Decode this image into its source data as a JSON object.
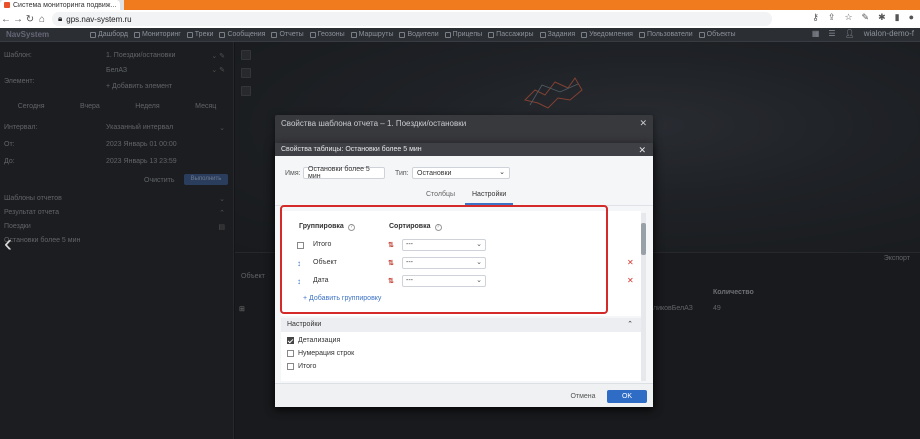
{
  "browser": {
    "tab_title": "Система мониторинга подвиж...",
    "url": "gps.nav-system.ru"
  },
  "app": {
    "logo": "NavSystem",
    "nav": [
      "Дашборд",
      "Мониторинг",
      "Треки",
      "Сообщения",
      "Отчеты",
      "Геозоны",
      "Маршруты",
      "Водители",
      "Прицепы",
      "Пассажиры",
      "Задания",
      "Уведомления",
      "Пользователи",
      "Объекты"
    ],
    "user": "wialon-demo-f"
  },
  "left_panel": {
    "template_label": "Шаблон:",
    "template_value": "1. Поездки/остановки",
    "element_label": "Элемент:",
    "element_value": "БелАЗ",
    "add_element": "+ Добавить элемент",
    "periods": [
      "Сегодня",
      "Вчера",
      "Неделя",
      "Месяц"
    ],
    "interval_label": "Интервал:",
    "interval_value": "Указанный интервал",
    "from_label": "От:",
    "from_value": "2023 Январь 01 00:00",
    "to_label": "До:",
    "to_value": "2023 Январь 13 23:59",
    "clear": "Очистить",
    "execute": "Выполнить",
    "templates": "Шаблоны отчетов",
    "result": "Результат отчета",
    "trips": "Поездки",
    "stops": "Остановки более 5 мин"
  },
  "report": {
    "object_label": "Объект",
    "col_count": "Количество",
    "export": "Экспорт",
    "cell_name": "ликовБелАЗ",
    "cell_count": "49"
  },
  "outer_dialog": {
    "title": "Свойства шаблона отчета – 1. Поездки/остановки"
  },
  "dialog": {
    "title": "Свойства таблицы: Остановки более 5 мин",
    "name_label": "Имя:",
    "name_value": "Остановки более 5 мин",
    "type_label": "Тип:",
    "type_value": "Остановки",
    "tabs": [
      "Столбцы",
      "Настройки"
    ],
    "active_tab": "Настройки",
    "grouping_header": "Группировка",
    "sorting_header": "Сортировка",
    "rows": [
      {
        "name": "Итого",
        "sort": "---",
        "draggable": false,
        "deletable": false
      },
      {
        "name": "Объект",
        "sort": "---",
        "draggable": true,
        "deletable": true
      },
      {
        "name": "Дата",
        "sort": "---",
        "draggable": true,
        "deletable": true
      }
    ],
    "add_grouping": "Добавить группировку",
    "settings_header": "Настройки",
    "settings": [
      {
        "label": "Детализация",
        "checked": true
      },
      {
        "label": "Нумерация строк",
        "checked": false
      },
      {
        "label": "Итого",
        "checked": false
      }
    ],
    "cancel": "Отмена",
    "ok": "OK"
  },
  "colors": {
    "accent": "#2f6cc6",
    "highlight": "#d42a2a",
    "delete": "#d9342b"
  }
}
